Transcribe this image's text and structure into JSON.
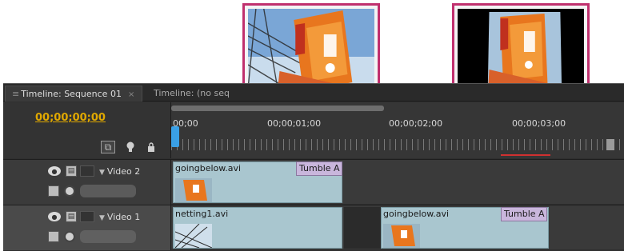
{
  "tabs": [
    {
      "label": "Timeline: Sequence 01",
      "close": "×"
    },
    {
      "label": "Timeline: (no seq"
    }
  ],
  "timecode": "00;00;00;00",
  "ruler": {
    "labels": [
      "00;00",
      "00;00;01;00",
      "00;00;02;00",
      "00;00;03;00"
    ]
  },
  "tracks": [
    {
      "name": "Video 2",
      "clips": [
        {
          "title": "goingbelow.avi",
          "transition": "Tumble A"
        }
      ]
    },
    {
      "name": "Video 1",
      "clips": [
        {
          "title": "netting1.avi"
        },
        {
          "title": "goingbelow.avi",
          "transition": "Tumble A"
        }
      ]
    }
  ],
  "icons": {
    "snap": "snap-icon",
    "marker": "set-marker-icon",
    "lock": "lock-icon",
    "visibility": "eye-icon",
    "film": "film-icon",
    "keyframe": "keyframe-icon"
  },
  "colors": {
    "callout_border": "#c0306e",
    "timecode": "#e0a800",
    "clip": "#a9c6cf",
    "transition": "#c9b6dc",
    "playhead": "#3aa0e6"
  }
}
